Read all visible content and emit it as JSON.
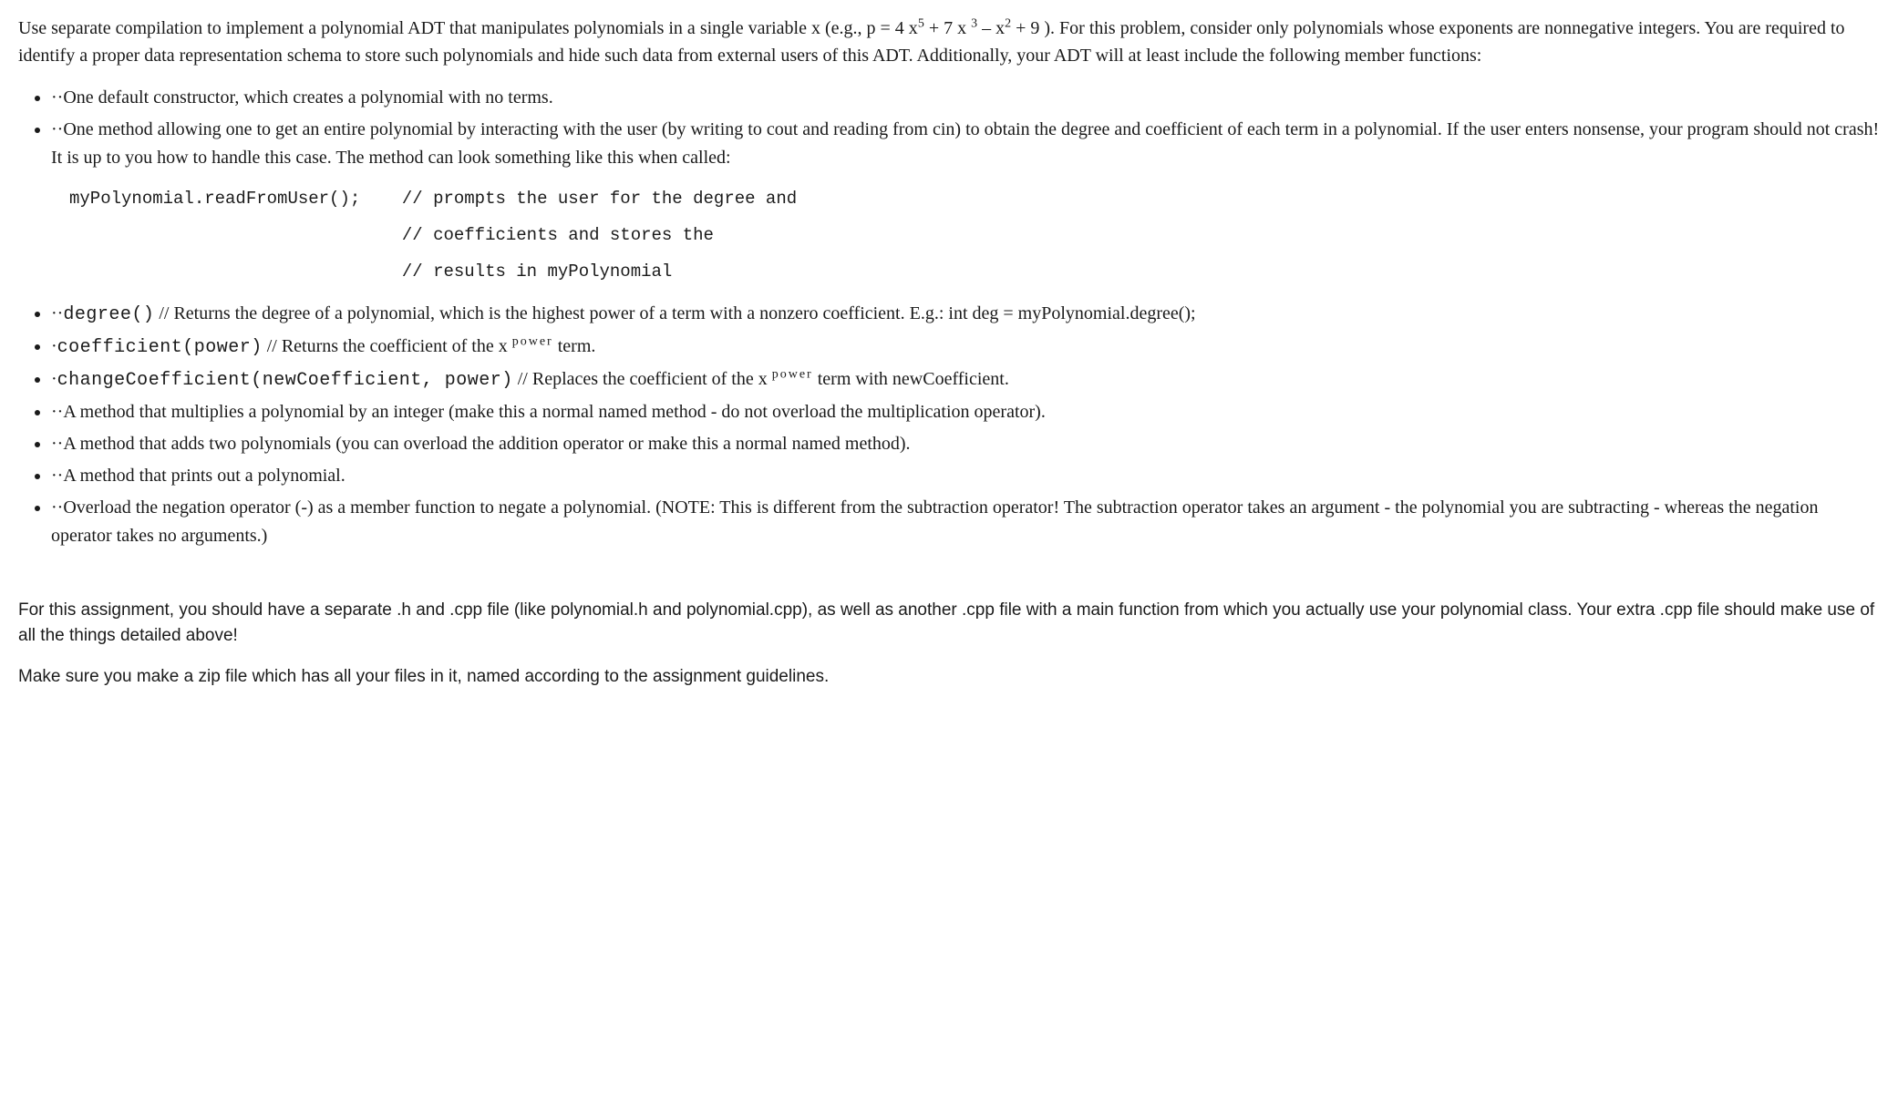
{
  "intro": {
    "part1": "Use separate compilation to implement a polynomial ADT that manipulates polynomials in a single variable x (e.g., p = 4 x",
    "exp1": "5",
    "part2": " + 7 x ",
    "exp2": "3",
    "part3": " – x",
    "exp3": "2",
    "part4": " + 9 ). For this problem, consider only polynomials whose exponents are nonnegative integers. You are required to identify a proper data representation schema to store such polynomials and hide such data from external users of this ADT. Additionally, your ADT will at least include the following member functions:"
  },
  "items": {
    "i1": "··One default constructor, which creates a polynomial with no terms.",
    "i2": "··One method allowing one to get an entire polynomial by interacting with the user (by writing to cout and reading from cin) to obtain the degree and coefficient of each term in a polynomial. If the user enters nonsense, your program should not crash! It is up to you how to handle this case. The method can look something like this when called:",
    "code": "myPolynomial.readFromUser();    // prompts the user for the degree and\n                                // coefficients and stores the\n                                // results in myPolynomial",
    "i3_prefix": "··",
    "i3_code": "degree()",
    "i3_rest": " // Returns the degree of a polynomial, which is the highest power of a term with a nonzero coefficient. E.g.: int deg = myPolynomial.degree();",
    "i4_prefix": "·",
    "i4_code": "coefficient(power)",
    "i4_rest_a": " // Returns the coefficient of the x ",
    "i4_sup": "power",
    "i4_rest_b": " term.",
    "i5_prefix": "·",
    "i5_code": "changeCoefficient(newCoefficient, power)",
    "i5_rest_a": " // Replaces the coefficient of the x ",
    "i5_sup": "power",
    "i5_rest_b": " term with newCoefficient.",
    "i6": "··A method that multiplies a polynomial by an integer (make this a normal named method - do not overload the multiplication operator).",
    "i7": "··A method that adds two polynomials (you can overload the addition operator or make this a normal named method).",
    "i8": "··A method that prints out a polynomial.",
    "i9": "··Overload the negation operator (-) as a member function to negate a polynomial. (NOTE: This is different from the subtraction operator! The subtraction operator takes an argument - the polynomial you are subtracting - whereas the negation operator takes no arguments.)"
  },
  "footer": {
    "p1": "For this assignment, you should have a separate .h and .cpp file (like polynomial.h and polynomial.cpp), as well as another .cpp file with a main function from which you actually use your polynomial class. Your extra .cpp file should make use of all the things detailed above!",
    "p2": "Make sure you make a zip file which has all your files in it, named according to the assignment guidelines."
  }
}
